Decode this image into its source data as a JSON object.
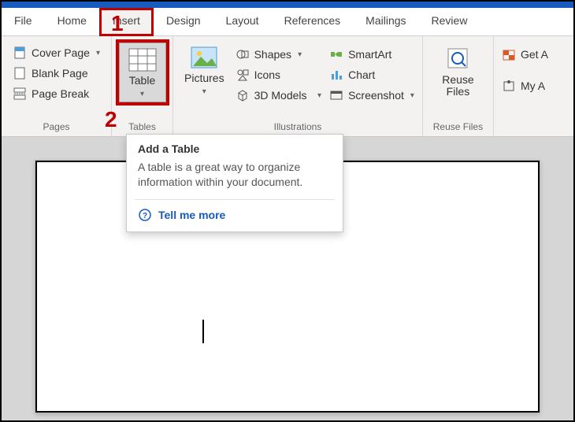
{
  "tabs": {
    "file": "File",
    "home": "Home",
    "insert": "Insert",
    "design": "Design",
    "layout": "Layout",
    "references": "References",
    "mailings": "Mailings",
    "review": "Review"
  },
  "pages_group": {
    "label": "Pages",
    "cover_page": "Cover Page",
    "blank_page": "Blank Page",
    "page_break": "Page Break"
  },
  "tables_group": {
    "label": "Tables",
    "table": "Table"
  },
  "illustrations_group": {
    "label": "Illustrations",
    "pictures": "Pictures",
    "shapes": "Shapes",
    "icons": "Icons",
    "models3d": "3D Models",
    "smartart": "SmartArt",
    "chart": "Chart",
    "screenshot": "Screenshot"
  },
  "reuse_group": {
    "label": "Reuse Files",
    "reuse_files": "Reuse\nFiles"
  },
  "right_group": {
    "get_addins": "Get A",
    "my_addins": "My A"
  },
  "annotations": {
    "one": "1",
    "two": "2"
  },
  "tooltip": {
    "title": "Add a Table",
    "body": "A table is a great way to organize information within your document.",
    "link": "Tell me more"
  }
}
